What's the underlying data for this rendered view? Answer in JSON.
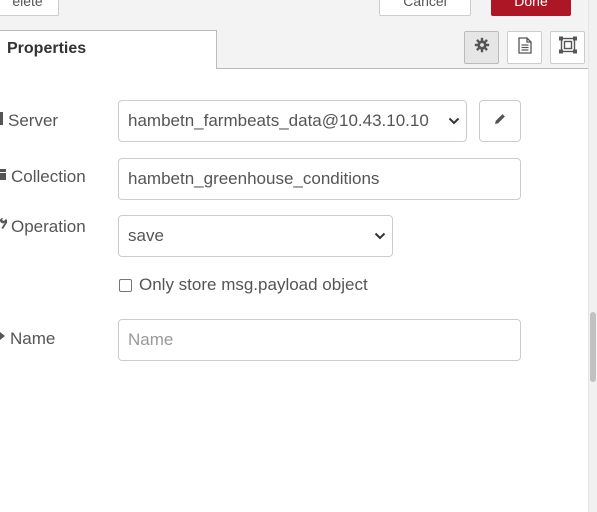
{
  "header": {
    "left_button_label": "elete",
    "cancel_label": "Cancel",
    "done_label": "Done",
    "done_color": "#ad1625"
  },
  "tabs": {
    "active_label": "Properties",
    "icons": [
      "gear-icon",
      "description-icon",
      "appearance-icon"
    ]
  },
  "form": {
    "server": {
      "label": "Server",
      "value": "hambetn_farmbeats_data@10.43.10.10",
      "icon": "database-icon"
    },
    "collection": {
      "label": "Collection",
      "value": "hambetn_greenhouse_conditions",
      "icon": "archive-icon"
    },
    "operation": {
      "label": "Operation",
      "value": "save",
      "icon": "wrench-icon"
    },
    "only_payload": {
      "label": "Only store msg.payload object",
      "checked": false
    },
    "name": {
      "label": "Name",
      "value": "",
      "placeholder": "Name",
      "icon": "tag-icon"
    }
  }
}
